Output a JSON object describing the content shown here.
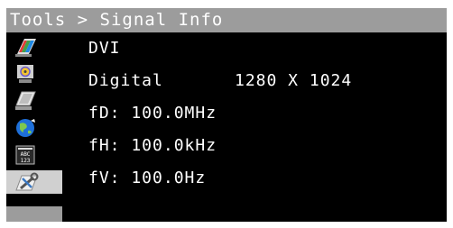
{
  "title": "Tools > Signal Info",
  "sidebar": {
    "icons": [
      "color-icon",
      "screen-icon",
      "power-manager-icon",
      "language-icon",
      "osd-settings-icon",
      "tools-icon"
    ],
    "selected": "tools-icon"
  },
  "signal": {
    "input": "DVI",
    "type": "Digital",
    "resolution": "1280 X 1024",
    "fd": "fD: 100.0MHz",
    "fh": "fH: 100.0kHz",
    "fv": "fV: 100.0Hz"
  },
  "colors": {
    "titlebar": "#9c9c9c",
    "background": "#000000",
    "text": "#ffffff",
    "selected": "#d0d0d0"
  }
}
